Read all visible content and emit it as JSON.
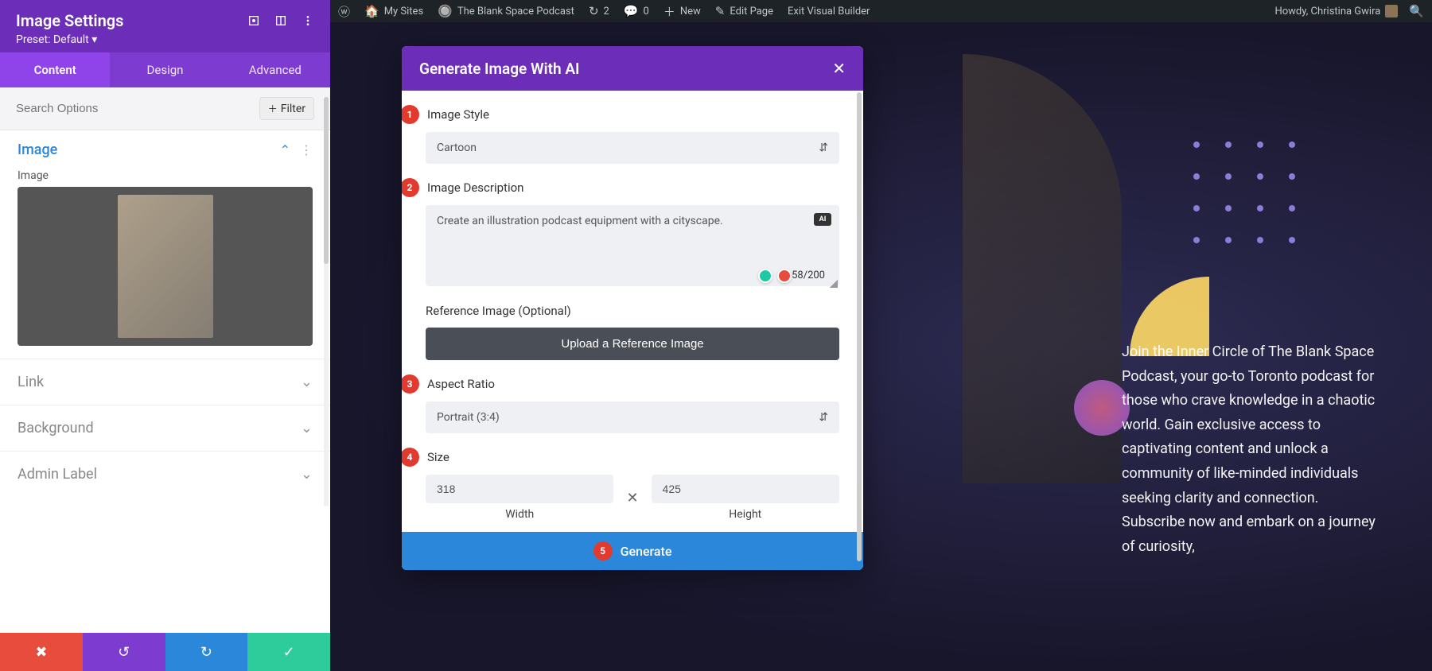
{
  "adminbar": {
    "my_sites": "My Sites",
    "site_name": "The Blank Space Podcast",
    "updates": "2",
    "comments": "0",
    "new": "New",
    "edit_page": "Edit Page",
    "exit_visual": "Exit Visual Builder",
    "howdy": "Howdy, Christina Gwira"
  },
  "settings": {
    "title": "Image Settings",
    "preset": "Preset: Default ▾",
    "tabs": {
      "content": "Content",
      "design": "Design",
      "advanced": "Advanced"
    },
    "search_placeholder": "Search Options",
    "filter": "Filter",
    "section_image": "Image",
    "image_label": "Image",
    "sections": {
      "link": "Link",
      "background": "Background",
      "admin_label": "Admin Label"
    }
  },
  "modal": {
    "title": "Generate Image With AI",
    "labels": {
      "style": "Image Style",
      "desc": "Image Description",
      "ref": "Reference Image (Optional)",
      "aspect": "Aspect Ratio",
      "size": "Size",
      "width": "Width",
      "height": "Height"
    },
    "style_value": "Cartoon",
    "desc_value": "Create an illustration podcast equipment with a cityscape.",
    "ai_tag": "AI",
    "char_count": "58/200",
    "upload": "Upload a Reference Image",
    "aspect_value": "Portrait (3:4)",
    "width_value": "318",
    "height_value": "425",
    "generate": "Generate",
    "badges": {
      "n1": "1",
      "n2": "2",
      "n3": "3",
      "n4": "4",
      "n5": "5"
    }
  },
  "page": {
    "blurb": "Join the Inner Circle of The Blank Space Podcast, your go-to Toronto podcast for those who crave knowledge in a chaotic world. Gain exclusive access to captivating content and unlock a community of like-minded individuals seeking clarity and connection. Subscribe now and embark on a journey of curiosity,"
  }
}
